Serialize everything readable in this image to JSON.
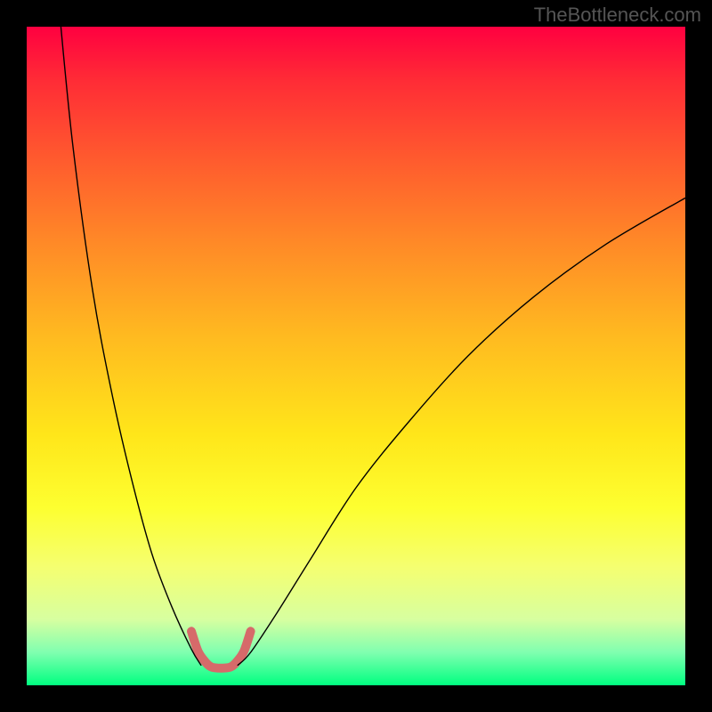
{
  "attribution": "TheBottleneck.com",
  "chart_data": {
    "type": "line",
    "title": "",
    "xlabel": "",
    "ylabel": "",
    "xlim": [
      0,
      100
    ],
    "ylim": [
      0,
      100
    ],
    "series": [
      {
        "name": "left-branch",
        "x": [
          5,
          7,
          10,
          13,
          16,
          19,
          22,
          25,
          26.5
        ],
        "y": [
          102,
          82,
          60,
          44,
          31,
          20,
          12,
          5.5,
          3
        ],
        "stroke": "#000000",
        "strokeWidth": 1.4
      },
      {
        "name": "right-branch",
        "x": [
          32,
          34,
          38,
          43,
          50,
          58,
          67,
          77,
          88,
          100
        ],
        "y": [
          3,
          5,
          11,
          19,
          30,
          40,
          50,
          59,
          67,
          74
        ],
        "stroke": "#000000",
        "strokeWidth": 1.4
      },
      {
        "name": "valley-highlight",
        "x": [
          25,
          26,
          27,
          28,
          29.5,
          31,
          32,
          33,
          34
        ],
        "y": [
          8.2,
          5.2,
          3.7,
          2.8,
          2.6,
          2.8,
          3.7,
          5.2,
          8.2
        ],
        "stroke": "#d66a6a",
        "strokeWidth": 10
      }
    ],
    "background_gradient": {
      "top": "#ff0040",
      "bottom": "#00ff80"
    }
  }
}
